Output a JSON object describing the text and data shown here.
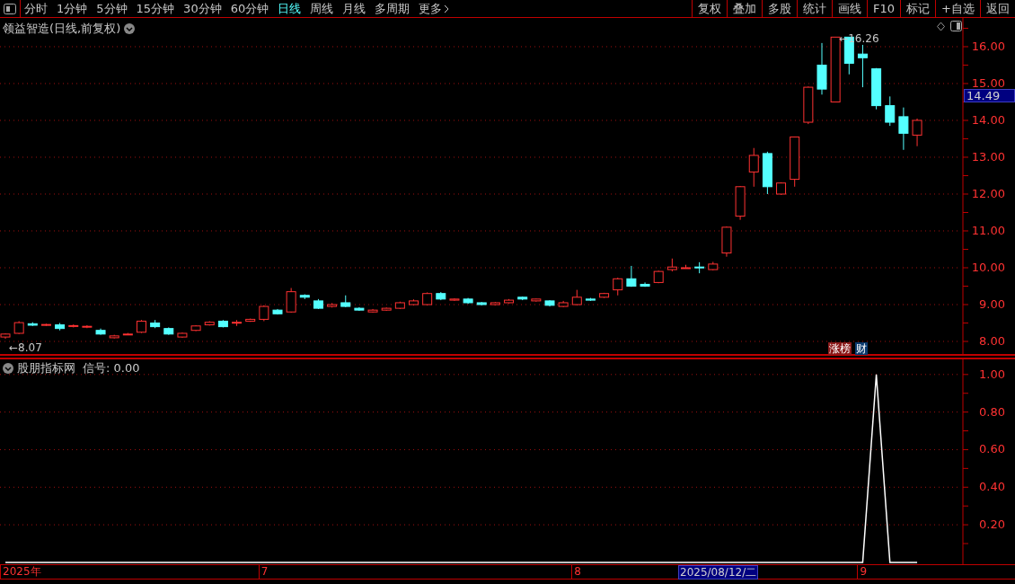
{
  "toolbar": {
    "periods": [
      {
        "label": "分时",
        "selected": false
      },
      {
        "label": "1分钟",
        "selected": false
      },
      {
        "label": "5分钟",
        "selected": false
      },
      {
        "label": "15分钟",
        "selected": false
      },
      {
        "label": "30分钟",
        "selected": false
      },
      {
        "label": "60分钟",
        "selected": false
      },
      {
        "label": "日线",
        "selected": true
      },
      {
        "label": "周线",
        "selected": false
      },
      {
        "label": "月线",
        "selected": false
      },
      {
        "label": "多周期",
        "selected": false
      },
      {
        "label": "更多",
        "selected": false
      }
    ],
    "actions": [
      "复权",
      "叠加",
      "多股",
      "统计",
      "画线",
      "F10",
      "标记",
      "+自选",
      "返回"
    ]
  },
  "price_panel": {
    "title": "领益智造(日线,前复权)",
    "current_price": "14.49",
    "badges": [
      {
        "label": "涨榜",
        "color": "#8b1a1a"
      },
      {
        "label": "财",
        "color": "#0a3a6e"
      }
    ],
    "chart_data": {
      "type": "candlestick",
      "grid": true,
      "ylim": [
        7.61,
        16.78
      ],
      "yticks": [
        {
          "value": 8,
          "label": "8.00"
        },
        {
          "value": 9,
          "label": "9.00"
        },
        {
          "value": 10,
          "label": "10.00"
        },
        {
          "value": 11,
          "label": "11.00"
        },
        {
          "value": 12,
          "label": "12.00"
        },
        {
          "value": 13,
          "label": "13.00"
        },
        {
          "value": 14,
          "label": "14.00"
        },
        {
          "value": 15,
          "label": "15.00"
        },
        {
          "value": 16,
          "label": "16.00"
        }
      ],
      "annotations": [
        "←16.26",
        "←8.07"
      ],
      "ohlc": [
        [
          8.12,
          8.22,
          8.07,
          8.2
        ],
        [
          8.22,
          8.55,
          8.2,
          8.51
        ],
        [
          8.48,
          8.52,
          8.42,
          8.44
        ],
        [
          8.44,
          8.48,
          8.42,
          8.46
        ],
        [
          8.45,
          8.5,
          8.3,
          8.35
        ],
        [
          8.42,
          8.46,
          8.38,
          8.43
        ],
        [
          8.4,
          8.44,
          8.36,
          8.41
        ],
        [
          8.3,
          8.35,
          8.18,
          8.2
        ],
        [
          8.1,
          8.18,
          8.08,
          8.15
        ],
        [
          8.19,
          8.23,
          8.17,
          8.2
        ],
        [
          8.25,
          8.58,
          8.23,
          8.55
        ],
        [
          8.5,
          8.58,
          8.36,
          8.4
        ],
        [
          8.35,
          8.38,
          8.18,
          8.2
        ],
        [
          8.12,
          8.24,
          8.1,
          8.22
        ],
        [
          8.3,
          8.44,
          8.28,
          8.42
        ],
        [
          8.45,
          8.55,
          8.43,
          8.52
        ],
        [
          8.55,
          8.58,
          8.38,
          8.4
        ],
        [
          8.5,
          8.58,
          8.42,
          8.52
        ],
        [
          8.55,
          8.62,
          8.53,
          8.6
        ],
        [
          8.6,
          8.98,
          8.55,
          8.95
        ],
        [
          8.85,
          8.88,
          8.73,
          8.75
        ],
        [
          8.8,
          9.45,
          8.78,
          9.35
        ],
        [
          9.25,
          9.28,
          9.15,
          9.2
        ],
        [
          9.1,
          9.15,
          8.88,
          8.9
        ],
        [
          8.95,
          9.04,
          8.92,
          9.0
        ],
        [
          9.05,
          9.25,
          8.93,
          8.95
        ],
        [
          8.9,
          8.93,
          8.83,
          8.85
        ],
        [
          8.8,
          8.88,
          8.78,
          8.85
        ],
        [
          8.85,
          8.92,
          8.83,
          8.9
        ],
        [
          8.9,
          9.08,
          8.88,
          9.05
        ],
        [
          9.0,
          9.14,
          8.98,
          9.1
        ],
        [
          9.0,
          9.33,
          8.98,
          9.3
        ],
        [
          9.3,
          9.34,
          9.12,
          9.15
        ],
        [
          9.12,
          9.17,
          9.1,
          9.15
        ],
        [
          9.15,
          9.18,
          9.02,
          9.05
        ],
        [
          9.05,
          9.07,
          8.98,
          9.0
        ],
        [
          9.0,
          9.07,
          8.98,
          9.05
        ],
        [
          9.05,
          9.15,
          9.03,
          9.12
        ],
        [
          9.2,
          9.22,
          9.12,
          9.15
        ],
        [
          9.1,
          9.16,
          9.08,
          9.15
        ],
        [
          9.1,
          9.12,
          8.95,
          8.98
        ],
        [
          8.95,
          9.1,
          8.93,
          9.05
        ],
        [
          9.0,
          9.4,
          8.98,
          9.2
        ],
        [
          9.15,
          9.18,
          9.1,
          9.12
        ],
        [
          9.2,
          9.32,
          9.18,
          9.3
        ],
        [
          9.4,
          9.73,
          9.25,
          9.7
        ],
        [
          9.7,
          10.05,
          9.48,
          9.5
        ],
        [
          9.55,
          9.6,
          9.48,
          9.5
        ],
        [
          9.6,
          9.92,
          9.58,
          9.9
        ],
        [
          9.95,
          10.25,
          9.9,
          10.02
        ],
        [
          10.0,
          10.08,
          9.98,
          10.0
        ],
        [
          10.02,
          10.15,
          9.85,
          10.0
        ],
        [
          9.95,
          10.16,
          9.93,
          10.1
        ],
        [
          10.4,
          11.12,
          10.3,
          11.1
        ],
        [
          11.4,
          12.22,
          11.3,
          12.2
        ],
        [
          12.6,
          13.25,
          12.2,
          13.05
        ],
        [
          13.1,
          13.15,
          12.0,
          12.2
        ],
        [
          12.0,
          12.32,
          11.98,
          12.3
        ],
        [
          12.4,
          13.56,
          12.2,
          13.55
        ],
        [
          13.95,
          14.92,
          13.9,
          14.9
        ],
        [
          15.5,
          16.1,
          14.7,
          14.85
        ],
        [
          14.5,
          16.26,
          14.5,
          16.26
        ],
        [
          16.26,
          16.26,
          15.25,
          15.55
        ],
        [
          15.8,
          16.05,
          14.9,
          15.7
        ],
        [
          15.4,
          15.42,
          14.3,
          14.4
        ],
        [
          14.4,
          14.65,
          13.85,
          13.95
        ],
        [
          14.1,
          14.35,
          13.2,
          13.65
        ],
        [
          13.6,
          14.05,
          13.3,
          14.0
        ]
      ]
    }
  },
  "indicator_panel": {
    "title": "股朋指标网",
    "signal_label": "信号: 0.00",
    "cursor_date": "2025/08/12/二",
    "date_axis": [
      "2025年",
      "7",
      "8",
      "9"
    ],
    "chart_data": {
      "type": "line",
      "grid": true,
      "ylim": [
        -0.01,
        1.09
      ],
      "yticks": [
        {
          "value": 0.2,
          "label": "0.20"
        },
        {
          "value": 0.4,
          "label": "0.40"
        },
        {
          "value": 0.6,
          "label": "0.60"
        },
        {
          "value": 0.8,
          "label": "0.80"
        },
        {
          "value": 1.0,
          "label": "1.00"
        }
      ],
      "series": [
        {
          "color": "#ffffff",
          "values": [
            0,
            0,
            0,
            0,
            0,
            0,
            0,
            0,
            0,
            0,
            0,
            0,
            0,
            0,
            0,
            0,
            0,
            0,
            0,
            0,
            0,
            0,
            0,
            0,
            0,
            0,
            0,
            0,
            0,
            0,
            0,
            0,
            0,
            0,
            0,
            0,
            0,
            0,
            0,
            0,
            0,
            0,
            0,
            0,
            0,
            0,
            0,
            0,
            0,
            0,
            0,
            0,
            0,
            0,
            0,
            0,
            0,
            0,
            0,
            0,
            0,
            0,
            0,
            0,
            1,
            0,
            0,
            0
          ]
        }
      ]
    }
  }
}
